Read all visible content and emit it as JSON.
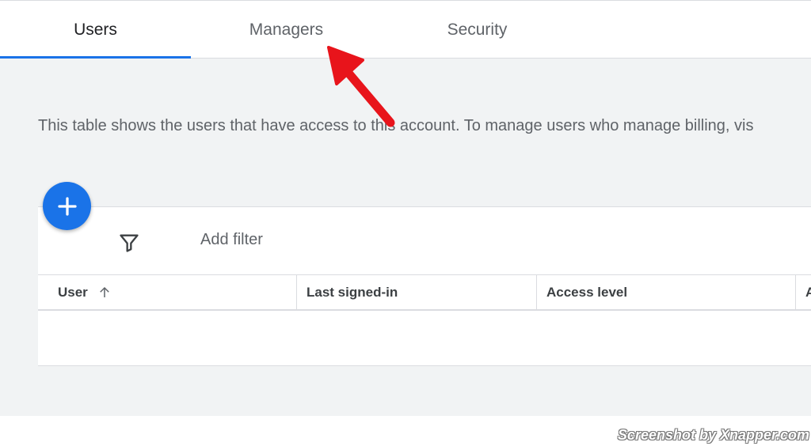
{
  "tabs": [
    {
      "label": "Users",
      "active": true
    },
    {
      "label": "Managers",
      "active": false
    },
    {
      "label": "Security",
      "active": false
    }
  ],
  "description": "This table shows the users that have access to this account. To manage users who manage billing, vis",
  "fab": {
    "icon": "plus-icon"
  },
  "filter": {
    "icon": "filter-icon",
    "label": "Add filter"
  },
  "table": {
    "columns": [
      "User",
      "Last signed-in",
      "Access level",
      "A"
    ],
    "sort": {
      "column": "User",
      "direction": "ascending",
      "icon": "arrow-up-icon"
    },
    "rows": []
  },
  "annotation": {
    "icon": "red-arrow-icon",
    "target": "Managers"
  },
  "watermark": "Screenshot by Xnapper.com",
  "colors": {
    "accent": "#1a73e8",
    "background": "#f1f3f4",
    "annotation": "#e8141b"
  }
}
